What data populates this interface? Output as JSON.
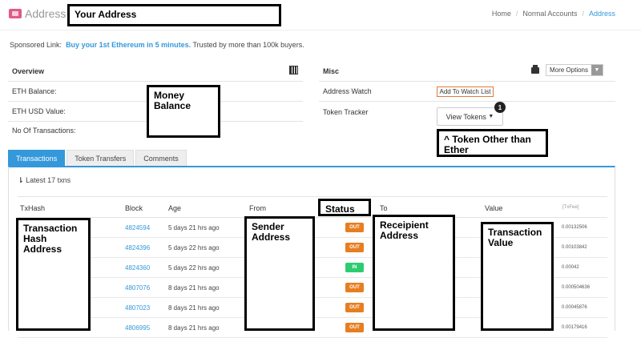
{
  "header": {
    "title": "Address",
    "annotation": "Your Address",
    "breadcrumb": [
      "Home",
      "Normal Accounts",
      "Address"
    ]
  },
  "sponsor": {
    "prefix": "Sponsored Link:",
    "link": "Buy your 1st Ethereum in 5 minutes.",
    "suffix": "Trusted by more than 100k buyers."
  },
  "overview": {
    "heading": "Overview",
    "eth_balance_label": "ETH Balance:",
    "eth_usd_label": "ETH USD Value:",
    "tx_count_label": "No Of Transactions:",
    "annotation": "Money Balance"
  },
  "misc": {
    "heading": "Misc",
    "more_options": "More Options",
    "address_watch_label": "Address Watch",
    "watch_button": "Add To Watch List",
    "token_tracker_label": "Token Tracker",
    "view_tokens": "View Tokens",
    "token_badge": "1",
    "annotation": "^ Token Other than Ether"
  },
  "tabs": [
    "Transactions",
    "Token Transfers",
    "Comments"
  ],
  "latest_txns": "Latest 17 txns",
  "table": {
    "headers": {
      "txhash": "TxHash",
      "block": "Block",
      "age": "Age",
      "from": "From",
      "status": "Status",
      "to": "To",
      "value": "Value",
      "fee": "[TxFee]"
    },
    "annotations": {
      "txhash": "Transaction Hash Address",
      "from": "Sender Address",
      "to": "Receipient Address",
      "value": "Transaction Value"
    },
    "rows": [
      {
        "block": "4824594",
        "age": "5 days 21 hrs ago",
        "status": "OUT",
        "fee": "0.00132506"
      },
      {
        "block": "4824396",
        "age": "5 days 22 hrs ago",
        "status": "OUT",
        "fee": "0.00103842"
      },
      {
        "block": "4824360",
        "age": "5 days 22 hrs ago",
        "status": "IN",
        "fee": "0.00042"
      },
      {
        "block": "4807076",
        "age": "8 days 21 hrs ago",
        "status": "OUT",
        "fee": "0.000504636"
      },
      {
        "block": "4807023",
        "age": "8 days 21 hrs ago",
        "status": "OUT",
        "fee": "0.00045876"
      },
      {
        "block": "4806995",
        "age": "8 days 21 hrs ago",
        "status": "OUT",
        "fee": "0.00179416"
      }
    ]
  },
  "colors": {
    "accent": "#3498db",
    "out": "#e67e22",
    "in": "#2ecc71"
  }
}
